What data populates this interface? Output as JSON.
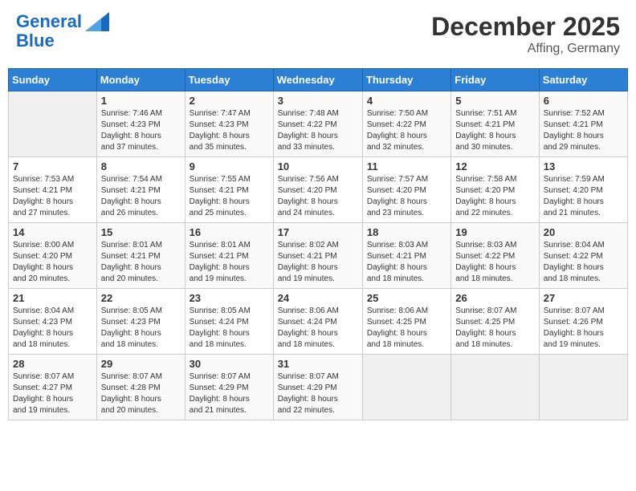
{
  "header": {
    "logo_line1": "General",
    "logo_line2": "Blue",
    "month": "December 2025",
    "location": "Affing, Germany"
  },
  "weekdays": [
    "Sunday",
    "Monday",
    "Tuesday",
    "Wednesday",
    "Thursday",
    "Friday",
    "Saturday"
  ],
  "weeks": [
    [
      {
        "day": "",
        "info": ""
      },
      {
        "day": "1",
        "info": "Sunrise: 7:46 AM\nSunset: 4:23 PM\nDaylight: 8 hours\nand 37 minutes."
      },
      {
        "day": "2",
        "info": "Sunrise: 7:47 AM\nSunset: 4:23 PM\nDaylight: 8 hours\nand 35 minutes."
      },
      {
        "day": "3",
        "info": "Sunrise: 7:48 AM\nSunset: 4:22 PM\nDaylight: 8 hours\nand 33 minutes."
      },
      {
        "day": "4",
        "info": "Sunrise: 7:50 AM\nSunset: 4:22 PM\nDaylight: 8 hours\nand 32 minutes."
      },
      {
        "day": "5",
        "info": "Sunrise: 7:51 AM\nSunset: 4:21 PM\nDaylight: 8 hours\nand 30 minutes."
      },
      {
        "day": "6",
        "info": "Sunrise: 7:52 AM\nSunset: 4:21 PM\nDaylight: 8 hours\nand 29 minutes."
      }
    ],
    [
      {
        "day": "7",
        "info": "Sunrise: 7:53 AM\nSunset: 4:21 PM\nDaylight: 8 hours\nand 27 minutes."
      },
      {
        "day": "8",
        "info": "Sunrise: 7:54 AM\nSunset: 4:21 PM\nDaylight: 8 hours\nand 26 minutes."
      },
      {
        "day": "9",
        "info": "Sunrise: 7:55 AM\nSunset: 4:21 PM\nDaylight: 8 hours\nand 25 minutes."
      },
      {
        "day": "10",
        "info": "Sunrise: 7:56 AM\nSunset: 4:20 PM\nDaylight: 8 hours\nand 24 minutes."
      },
      {
        "day": "11",
        "info": "Sunrise: 7:57 AM\nSunset: 4:20 PM\nDaylight: 8 hours\nand 23 minutes."
      },
      {
        "day": "12",
        "info": "Sunrise: 7:58 AM\nSunset: 4:20 PM\nDaylight: 8 hours\nand 22 minutes."
      },
      {
        "day": "13",
        "info": "Sunrise: 7:59 AM\nSunset: 4:20 PM\nDaylight: 8 hours\nand 21 minutes."
      }
    ],
    [
      {
        "day": "14",
        "info": "Sunrise: 8:00 AM\nSunset: 4:20 PM\nDaylight: 8 hours\nand 20 minutes."
      },
      {
        "day": "15",
        "info": "Sunrise: 8:01 AM\nSunset: 4:21 PM\nDaylight: 8 hours\nand 20 minutes."
      },
      {
        "day": "16",
        "info": "Sunrise: 8:01 AM\nSunset: 4:21 PM\nDaylight: 8 hours\nand 19 minutes."
      },
      {
        "day": "17",
        "info": "Sunrise: 8:02 AM\nSunset: 4:21 PM\nDaylight: 8 hours\nand 19 minutes."
      },
      {
        "day": "18",
        "info": "Sunrise: 8:03 AM\nSunset: 4:21 PM\nDaylight: 8 hours\nand 18 minutes."
      },
      {
        "day": "19",
        "info": "Sunrise: 8:03 AM\nSunset: 4:22 PM\nDaylight: 8 hours\nand 18 minutes."
      },
      {
        "day": "20",
        "info": "Sunrise: 8:04 AM\nSunset: 4:22 PM\nDaylight: 8 hours\nand 18 minutes."
      }
    ],
    [
      {
        "day": "21",
        "info": "Sunrise: 8:04 AM\nSunset: 4:23 PM\nDaylight: 8 hours\nand 18 minutes."
      },
      {
        "day": "22",
        "info": "Sunrise: 8:05 AM\nSunset: 4:23 PM\nDaylight: 8 hours\nand 18 minutes."
      },
      {
        "day": "23",
        "info": "Sunrise: 8:05 AM\nSunset: 4:24 PM\nDaylight: 8 hours\nand 18 minutes."
      },
      {
        "day": "24",
        "info": "Sunrise: 8:06 AM\nSunset: 4:24 PM\nDaylight: 8 hours\nand 18 minutes."
      },
      {
        "day": "25",
        "info": "Sunrise: 8:06 AM\nSunset: 4:25 PM\nDaylight: 8 hours\nand 18 minutes."
      },
      {
        "day": "26",
        "info": "Sunrise: 8:07 AM\nSunset: 4:25 PM\nDaylight: 8 hours\nand 18 minutes."
      },
      {
        "day": "27",
        "info": "Sunrise: 8:07 AM\nSunset: 4:26 PM\nDaylight: 8 hours\nand 19 minutes."
      }
    ],
    [
      {
        "day": "28",
        "info": "Sunrise: 8:07 AM\nSunset: 4:27 PM\nDaylight: 8 hours\nand 19 minutes."
      },
      {
        "day": "29",
        "info": "Sunrise: 8:07 AM\nSunset: 4:28 PM\nDaylight: 8 hours\nand 20 minutes."
      },
      {
        "day": "30",
        "info": "Sunrise: 8:07 AM\nSunset: 4:29 PM\nDaylight: 8 hours\nand 21 minutes."
      },
      {
        "day": "31",
        "info": "Sunrise: 8:07 AM\nSunset: 4:29 PM\nDaylight: 8 hours\nand 22 minutes."
      },
      {
        "day": "",
        "info": ""
      },
      {
        "day": "",
        "info": ""
      },
      {
        "day": "",
        "info": ""
      }
    ]
  ]
}
